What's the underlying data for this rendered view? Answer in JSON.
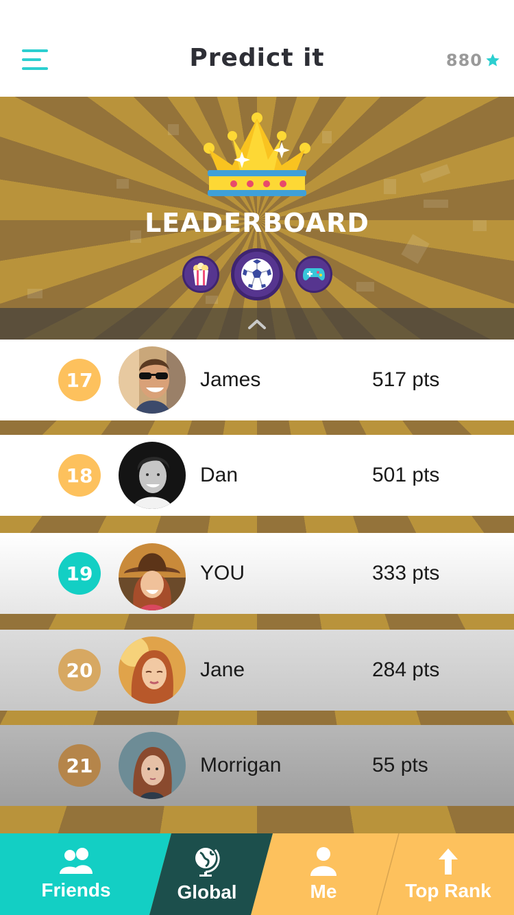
{
  "header": {
    "title": "Predict it",
    "score": "880"
  },
  "leaderboard": {
    "title": "LEADERBOARD",
    "categories": [
      {
        "icon": "popcorn-icon"
      },
      {
        "icon": "soccer-ball-icon",
        "selected": true
      },
      {
        "icon": "gamepad-icon"
      }
    ],
    "rows": [
      {
        "rank": "17",
        "name": "James",
        "points": "517 pts",
        "highlight": false
      },
      {
        "rank": "18",
        "name": "Dan",
        "points": "501 pts",
        "highlight": false
      },
      {
        "rank": "19",
        "name": "YOU",
        "points": "333 pts",
        "highlight": true
      },
      {
        "rank": "20",
        "name": "Jane",
        "points": "284 pts",
        "highlight": false
      },
      {
        "rank": "21",
        "name": "Morrigan",
        "points": "55 pts",
        "highlight": false
      }
    ]
  },
  "tabs": [
    {
      "label": "Friends",
      "icon": "friends-icon"
    },
    {
      "label": "Global",
      "icon": "globe-icon",
      "active": true
    },
    {
      "label": "Me",
      "icon": "user-icon"
    },
    {
      "label": "Top Rank",
      "icon": "arrow-up-icon"
    }
  ],
  "colors": {
    "accent": "#2ccfd0",
    "rank_badge": "#fdc15d",
    "you_badge": "#13cfc4",
    "active_tab": "#1c4f4c",
    "tab_bar": "#fdc15d",
    "category": "#56358f"
  }
}
